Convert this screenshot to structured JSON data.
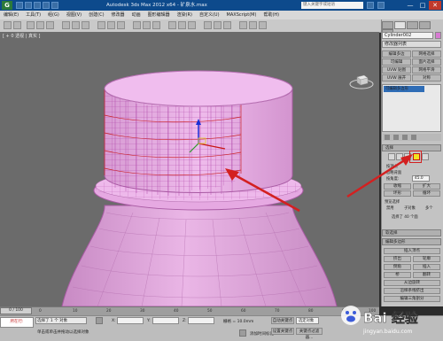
{
  "window": {
    "title": "Autodesk 3ds Max 2012 x64 - 矿泉水.max",
    "search_placeholder": "键入关键字或短语",
    "minimize": "—",
    "maximize": "□",
    "close": "✕"
  },
  "menu": [
    "编辑(E)",
    "工具(T)",
    "组(G)",
    "视图(V)",
    "创建(C)",
    "修改器",
    "动画",
    "图形编辑器",
    "渲染(R)",
    "自定义(U)",
    "MAXScript(M)",
    "帮助(H)"
  ],
  "viewport": {
    "label": "[ + 0 透视 | 真实 ]"
  },
  "command_panel": {
    "object_name": "Cylinder002",
    "modifier_list": "修改器列表",
    "buttons": [
      "编辑多边",
      "网格选择",
      "可编辑",
      "面片选择",
      "UVW 贴图",
      "网格平滑",
      "UVW 展开",
      "对称"
    ],
    "stack_item": "可编辑多边形",
    "selection_rollout": "选择",
    "selection_options": {
      "by_vertex": "按顶点",
      "ignore_backfacing": "忽略背面",
      "by_angle": "按角度:",
      "angle_value": "45.0",
      "shrink": "收缩",
      "grow": "扩大",
      "ring": "环形",
      "loop": "循环",
      "preview_selection": "预览选择",
      "disabled": "禁用",
      "subobject": "子对象",
      "multi": "多个",
      "selected_count": "选择了 40 个面"
    },
    "soft_selection": "软选择",
    "edit_polygons": "编辑多边形",
    "edit_buttons": [
      "插入顶点",
      "挤出",
      "轮廓",
      "倒角",
      "插入",
      "桥",
      "翻转",
      "从边旋转",
      "沿样条线挤出",
      "编辑三角剖分",
      "重复三角算法",
      "旋转"
    ]
  },
  "timeline": {
    "slider": "0 / 100",
    "ticks": [
      "0",
      "10",
      "20",
      "30",
      "40",
      "50",
      "60",
      "70",
      "80",
      "90",
      "100"
    ]
  },
  "status": {
    "script_label": "所在行:",
    "line1": "选择了 1 个 对象",
    "line2": "单击或单击并拖动以选择对象",
    "x_label": "X:",
    "y_label": "Y:",
    "z_label": "Z:",
    "grid": "栅格 = 10.0mm",
    "autokey": "自动关键点",
    "selected": "选定对象",
    "set_key": "设置关键点",
    "key_filter": "关键点过滤器...",
    "add_time_tag": "添加时间标记"
  },
  "watermark": {
    "text": "Bai 经验",
    "url": "jingyan.baidu.com"
  },
  "colors": {
    "mesh_fill": "#e5a6e1",
    "mesh_line": "#a34a9d",
    "selection_red": "#c91515",
    "viewport_bg": "#6b6b6b",
    "titlebar": "#0d4a8c"
  }
}
